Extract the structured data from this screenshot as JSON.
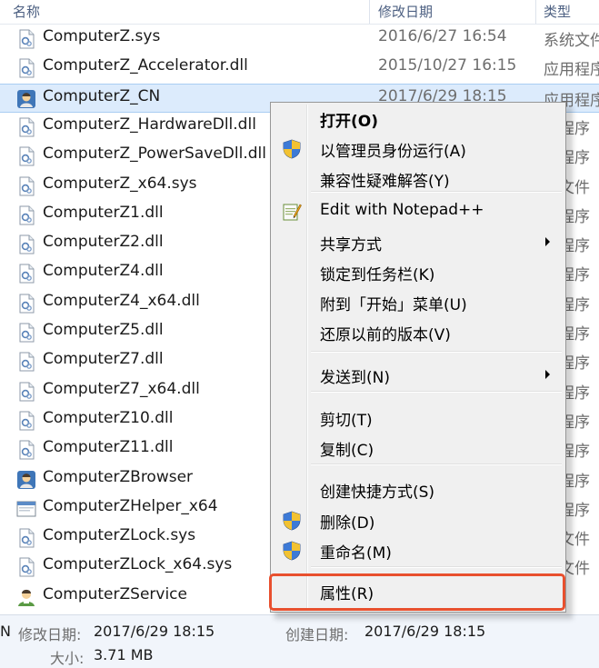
{
  "columns": {
    "name": "名称",
    "date": "修改日期",
    "type": "类型"
  },
  "files": [
    {
      "name": "ComputerZ.sys",
      "date": "2016/6/27 16:54",
      "type": "系统文件",
      "icon": "sys-file-icon"
    },
    {
      "name": "ComputerZ_Accelerator.dll",
      "date": "2015/10/27 16:15",
      "type": "应用程序",
      "icon": "dll-file-icon"
    },
    {
      "name": "ComputerZ_CN",
      "date": "2017/6/29 18:15",
      "type": "应用程序",
      "icon": "app-exe-icon",
      "selected": true
    },
    {
      "name": "ComputerZ_HardwareDll.dll",
      "date": "",
      "type": "用程序",
      "icon": "dll-file-icon"
    },
    {
      "name": "ComputerZ_PowerSaveDll.dll",
      "date": "",
      "type": "用程序",
      "icon": "dll-file-icon"
    },
    {
      "name": "ComputerZ_x64.sys",
      "date": "",
      "type": "充文件",
      "icon": "sys-file-icon"
    },
    {
      "name": "ComputerZ1.dll",
      "date": "",
      "type": "用程序",
      "icon": "dll-file-icon"
    },
    {
      "name": "ComputerZ2.dll",
      "date": "",
      "type": "用程序",
      "icon": "dll-file-icon"
    },
    {
      "name": "ComputerZ4.dll",
      "date": "",
      "type": "用程序",
      "icon": "dll-file-icon"
    },
    {
      "name": "ComputerZ4_x64.dll",
      "date": "",
      "type": "用程序",
      "icon": "dll-file-icon"
    },
    {
      "name": "ComputerZ5.dll",
      "date": "",
      "type": "用程序",
      "icon": "dll-file-icon"
    },
    {
      "name": "ComputerZ7.dll",
      "date": "",
      "type": "用程序",
      "icon": "dll-file-icon"
    },
    {
      "name": "ComputerZ7_x64.dll",
      "date": "",
      "type": "用程序",
      "icon": "dll-file-icon"
    },
    {
      "name": "ComputerZ10.dll",
      "date": "",
      "type": "用程序",
      "icon": "dll-file-icon"
    },
    {
      "name": "ComputerZ11.dll",
      "date": "",
      "type": "用程序",
      "icon": "dll-file-icon"
    },
    {
      "name": "ComputerZBrowser",
      "date": "",
      "type": "用程序",
      "icon": "app-exe-icon"
    },
    {
      "name": "ComputerZHelper_x64",
      "date": "",
      "type": "用程序",
      "icon": "window-exe-icon"
    },
    {
      "name": "ComputerZLock.sys",
      "date": "",
      "type": "充文件",
      "icon": "sys-file-icon"
    },
    {
      "name": "ComputerZLock_x64.sys",
      "date": "",
      "type": "充文件",
      "icon": "sys-file-icon"
    },
    {
      "name": "ComputerZService",
      "date": "",
      "type": "",
      "icon": "service-exe-icon"
    }
  ],
  "status": {
    "name_fragment": "N",
    "modified_label": "修改日期:",
    "modified_value": "2017/6/29 18:15",
    "created_label": "创建日期:",
    "created_value": "2017/6/29 18:15",
    "size_label": "大小:",
    "size_value": "3.71 MB"
  },
  "menu": {
    "items": [
      {
        "label": "打开(O)",
        "bold": true
      },
      {
        "label": "以管理员身份运行(A)",
        "icon": "uac-shield-icon"
      },
      {
        "label": "兼容性疑难解答(Y)"
      },
      {
        "label": "Edit with Notepad++",
        "icon": "notepad-plus-plus-icon"
      },
      {
        "label": "共享方式",
        "submenu": true
      },
      {
        "label": "锁定到任务栏(K)"
      },
      {
        "label": "附到「开始」菜单(U)"
      },
      {
        "label": "还原以前的版本(V)"
      },
      {
        "label": "发送到(N)",
        "submenu": true
      },
      {
        "label": "剪切(T)"
      },
      {
        "label": "复制(C)"
      },
      {
        "label": "创建快捷方式(S)"
      },
      {
        "label": "删除(D)",
        "icon": "uac-shield-icon"
      },
      {
        "label": "重命名(M)",
        "icon": "uac-shield-icon"
      },
      {
        "label": "属性(R)",
        "highlighted": true
      }
    ]
  },
  "colors": {
    "selection": "#dcebfc",
    "highlight_border": "#e8502e",
    "menu_bg": "#f0f0f0"
  }
}
